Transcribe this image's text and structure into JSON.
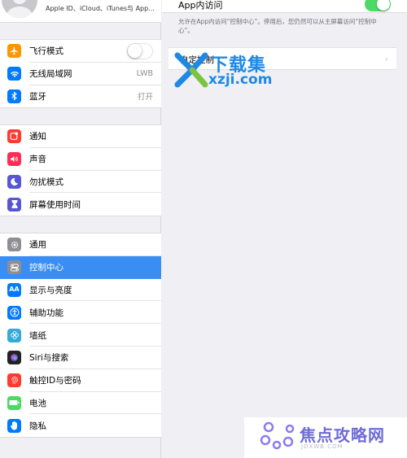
{
  "sidebar": {
    "profile": {
      "subtitle": "Apple ID、iCloud、iTunes与 App..."
    },
    "group1": [
      {
        "label": "飞行模式",
        "icon": "airplane-icon",
        "color": "#ff9500",
        "control": "toggle",
        "toggle_on": false
      },
      {
        "label": "无线局域网",
        "icon": "wifi-icon",
        "color": "#007aff",
        "value": "LWB"
      },
      {
        "label": "蓝牙",
        "icon": "bluetooth-icon",
        "color": "#007aff",
        "value": "打开"
      }
    ],
    "group2": [
      {
        "label": "通知",
        "icon": "notifications-icon",
        "color": "#ff3b30"
      },
      {
        "label": "声音",
        "icon": "sound-icon",
        "color": "#ff2d55"
      },
      {
        "label": "勿扰模式",
        "icon": "moon-icon",
        "color": "#5856d6"
      },
      {
        "label": "屏幕使用时间",
        "icon": "hourglass-icon",
        "color": "#5856d6"
      }
    ],
    "group3": [
      {
        "label": "通用",
        "icon": "gear-icon",
        "color": "#8e8e93"
      },
      {
        "label": "控制中心",
        "icon": "control-center-icon",
        "color": "#8e8e93",
        "selected": true
      },
      {
        "label": "显示与亮度",
        "icon": "display-icon",
        "color": "#007aff"
      },
      {
        "label": "辅助功能",
        "icon": "accessibility-icon",
        "color": "#007aff"
      },
      {
        "label": "墙纸",
        "icon": "wallpaper-icon",
        "color": "#34aadc"
      },
      {
        "label": "Siri与搜索",
        "icon": "siri-icon",
        "color": "#222222"
      },
      {
        "label": "触控ID与密码",
        "icon": "fingerprint-icon",
        "color": "#ff3b30"
      },
      {
        "label": "电池",
        "icon": "battery-icon",
        "color": "#4cd964"
      },
      {
        "label": "隐私",
        "icon": "hand-icon",
        "color": "#007aff"
      }
    ]
  },
  "main": {
    "access_title": "App内访问",
    "access_toggle_on": true,
    "footnote": "允许在App内访问“控制中心”。停用后，您仍然可以从主屏幕访问“控制中心”。",
    "custom_label": "自定控制",
    "chevron": "›"
  },
  "watermarks": {
    "top_cn": "下载集",
    "top_url": "xzji.com",
    "bottom_cn": "焦点攻略网",
    "bottom_url": "JDXWB.COM"
  },
  "colors": {
    "accent": "#3a8ef3",
    "toggle_on": "#4cd964",
    "watermark_blue": "#1e88e5",
    "watermark_purple": "#6e6bd8"
  }
}
